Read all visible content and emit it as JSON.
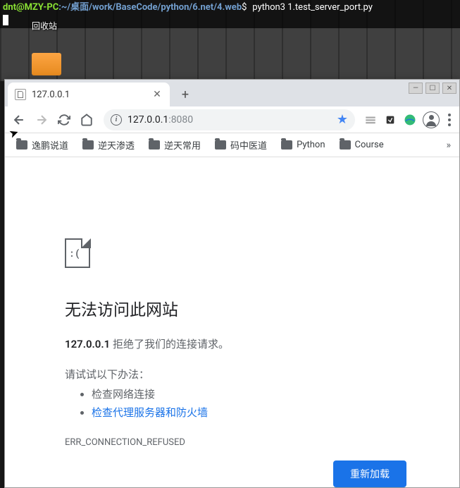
{
  "terminal": {
    "user_host": "dnt@MZY-PC",
    "path": ":~/桌面/work/BaseCode/python/6.net/4.web",
    "prompt": "$",
    "command": "python3 1.test_server_port.py"
  },
  "desktop": {
    "icon_label": "回收站"
  },
  "window_controls": {
    "min": "—",
    "max": "☐",
    "close": "✕"
  },
  "tab": {
    "title": "127.0.0.1",
    "close": "✕"
  },
  "newtab": "+",
  "omnibox": {
    "url_host": "127.0.0.1",
    "url_port": ":8080",
    "star": "★"
  },
  "bookmarks": {
    "items": [
      {
        "label": "逸鹏说道"
      },
      {
        "label": "逆天渗透"
      },
      {
        "label": "逆天常用"
      },
      {
        "label": "码中医道"
      },
      {
        "label": "Python"
      },
      {
        "label": "Course"
      }
    ],
    "overflow": "»"
  },
  "error": {
    "title": "无法访问此网站",
    "host_bold": "127.0.0.1",
    "refused_text": " 拒绝了我们的连接请求。",
    "suggest": "请试试以下办法：",
    "suggestions": {
      "check_network": "检查网络连接",
      "check_proxy": "检查代理服务器和防火墙"
    },
    "code": "ERR_CONNECTION_REFUSED",
    "reload_btn": "重新加载"
  }
}
